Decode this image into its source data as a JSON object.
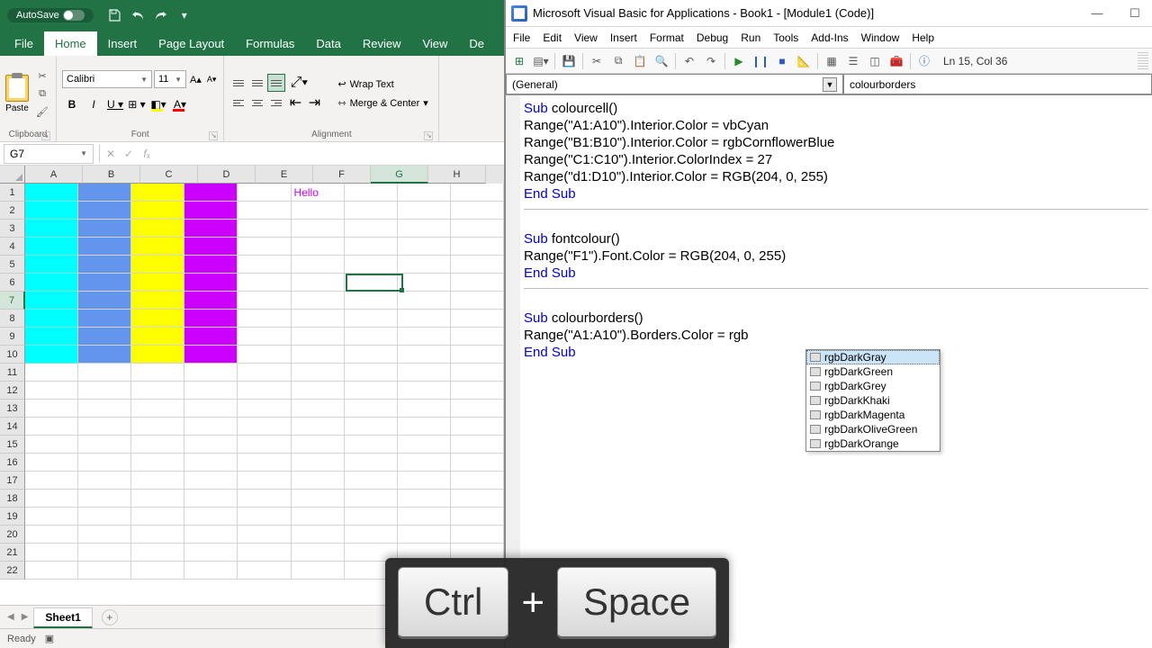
{
  "excel": {
    "titlebar": {
      "autosave_label": "AutoSave"
    },
    "tabs": [
      "File",
      "Home",
      "Insert",
      "Page Layout",
      "Formulas",
      "Data",
      "Review",
      "View",
      "De"
    ],
    "active_tab": 1,
    "clipboard": {
      "paste": "Paste",
      "group_label": "Clipboard"
    },
    "font": {
      "name": "Calibri",
      "size": "11",
      "group_label": "Font"
    },
    "alignment": {
      "wrap": "Wrap Text",
      "merge": "Merge & Center",
      "group_label": "Alignment"
    },
    "namebox": "G7",
    "columns": [
      "A",
      "B",
      "C",
      "D",
      "E",
      "F",
      "G",
      "H"
    ],
    "rows": [
      "1",
      "2",
      "3",
      "4",
      "5",
      "6",
      "7",
      "8",
      "9",
      "10",
      "11",
      "12",
      "13",
      "14",
      "15",
      "16",
      "17",
      "18",
      "19",
      "20",
      "21",
      "22"
    ],
    "f1_value": "Hello",
    "sheet": "Sheet1",
    "status": "Ready"
  },
  "vba": {
    "title": "Microsoft Visual Basic for Applications - Book1 - [Module1 (Code)]",
    "menu": [
      "File",
      "Edit",
      "View",
      "Insert",
      "Format",
      "Debug",
      "Run",
      "Tools",
      "Add-Ins",
      "Window",
      "Help"
    ],
    "tb_status": "Ln 15, Col 36",
    "dd_left": "(General)",
    "dd_right": "colourborders",
    "code": {
      "l1a": "Sub",
      "l1b": " colourcell()",
      "l2": "Range(\"A1:A10\").Interior.Color = vbCyan",
      "l3": "Range(\"B1:B10\").Interior.Color = rgbCornflowerBlue",
      "l4": "Range(\"C1:C10\").Interior.ColorIndex = 27",
      "l5": "Range(\"d1:D10\").Interior.Color = RGB(204, 0, 255)",
      "l6a": "End",
      "l6b": " ",
      "l6c": "Sub",
      "l7a": "Sub",
      "l7b": " fontcolour()",
      "l8": "Range(\"F1\").Font.Color = RGB(204, 0, 255)",
      "l9a": "End",
      "l9b": " ",
      "l9c": "Sub",
      "l10a": "Sub",
      "l10b": " colourborders()",
      "l11": "Range(\"A1:A10\").Borders.Color = rgb",
      "l12a": "End",
      "l12b": " ",
      "l12c": "Sub"
    },
    "intellisense": [
      "rgbDarkGray",
      "rgbDarkGreen",
      "rgbDarkGrey",
      "rgbDarkKhaki",
      "rgbDarkMagenta",
      "rgbDarkOliveGreen",
      "rgbDarkOrange"
    ]
  },
  "keys": {
    "k1": "Ctrl",
    "plus": "+",
    "k2": "Space"
  }
}
